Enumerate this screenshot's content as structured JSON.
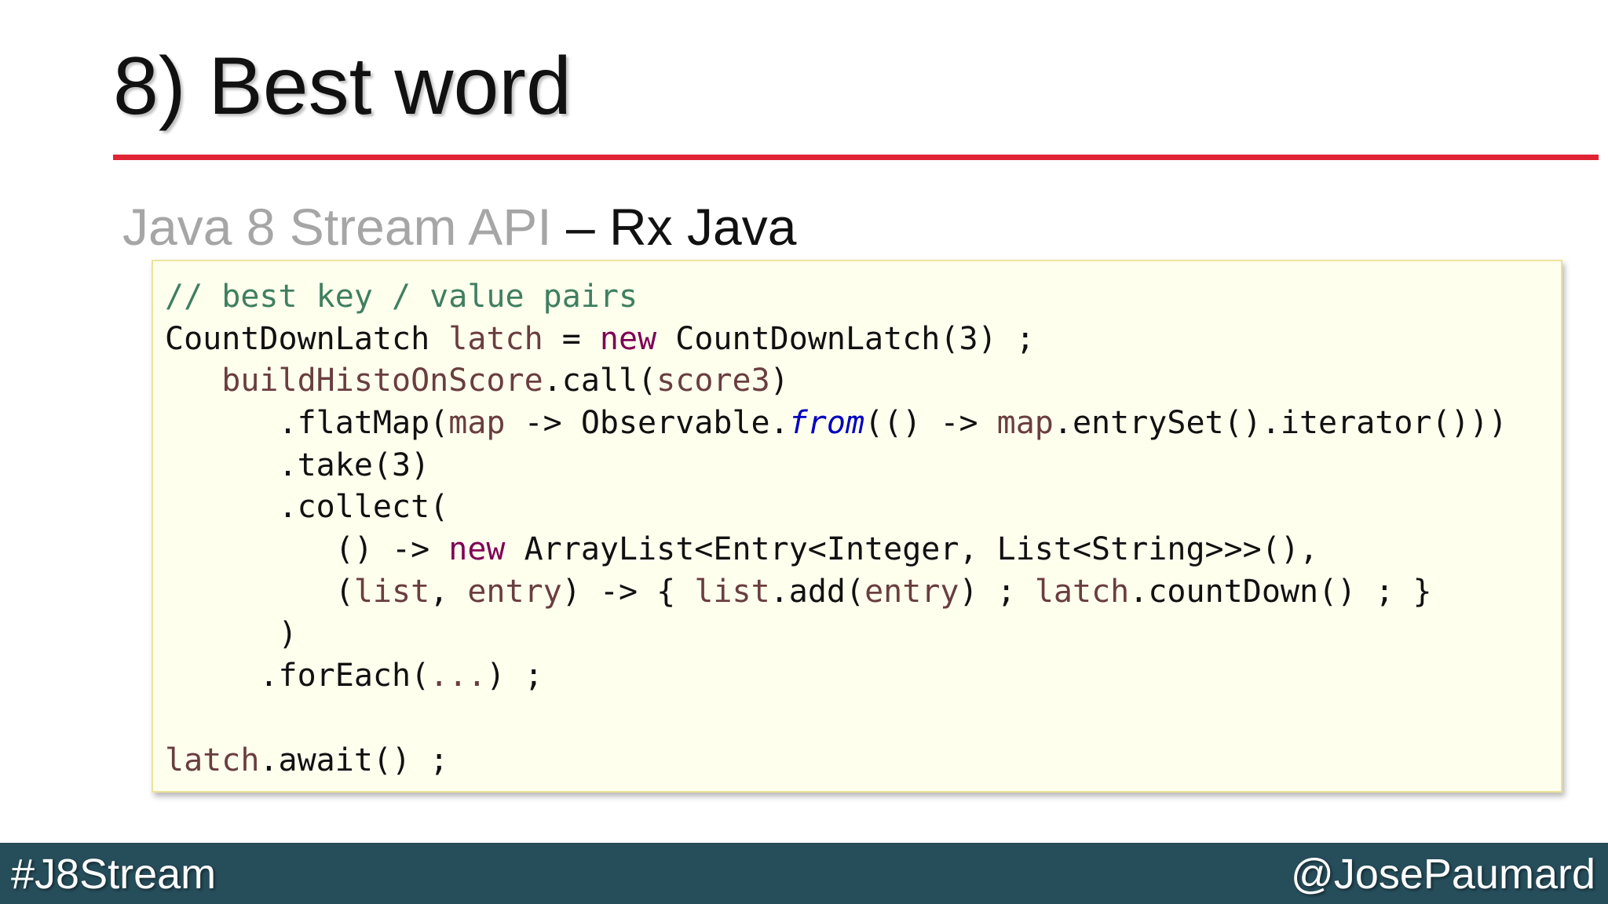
{
  "slide": {
    "title": "8) Best word",
    "subtitle": {
      "part1": "Java 8 Stream API",
      "separator": " – ",
      "part2": "Rx Java"
    },
    "code_lines": [
      [
        {
          "t": "// best key / value pairs",
          "c": "comment"
        }
      ],
      [
        {
          "t": "CountDownLatch ",
          "c": "plain"
        },
        {
          "t": "latch",
          "c": "var"
        },
        {
          "t": " = ",
          "c": "plain"
        },
        {
          "t": "new",
          "c": "keyword"
        },
        {
          "t": " CountDownLatch(3) ;",
          "c": "plain"
        }
      ],
      [
        {
          "t": "   ",
          "c": "plain"
        },
        {
          "t": "buildHistoOnScore",
          "c": "var"
        },
        {
          "t": ".call(",
          "c": "plain"
        },
        {
          "t": "score3",
          "c": "var"
        },
        {
          "t": ")",
          "c": "plain"
        }
      ],
      [
        {
          "t": "      .flatMap(",
          "c": "plain"
        },
        {
          "t": "map",
          "c": "var"
        },
        {
          "t": " -> Observable.",
          "c": "plain"
        },
        {
          "t": "from",
          "c": "static"
        },
        {
          "t": "(() -> ",
          "c": "plain"
        },
        {
          "t": "map",
          "c": "var"
        },
        {
          "t": ".entrySet().iterator()))",
          "c": "plain"
        }
      ],
      [
        {
          "t": "      .take(3)",
          "c": "plain"
        }
      ],
      [
        {
          "t": "      .collect(",
          "c": "plain"
        }
      ],
      [
        {
          "t": "         () -> ",
          "c": "plain"
        },
        {
          "t": "new",
          "c": "keyword"
        },
        {
          "t": " ArrayList<Entry<Integer, List<String>>>(),",
          "c": "plain"
        }
      ],
      [
        {
          "t": "         (",
          "c": "plain"
        },
        {
          "t": "list",
          "c": "var"
        },
        {
          "t": ", ",
          "c": "plain"
        },
        {
          "t": "entry",
          "c": "var"
        },
        {
          "t": ") -> { ",
          "c": "plain"
        },
        {
          "t": "list",
          "c": "var"
        },
        {
          "t": ".add(",
          "c": "plain"
        },
        {
          "t": "entry",
          "c": "var"
        },
        {
          "t": ") ; ",
          "c": "plain"
        },
        {
          "t": "latch",
          "c": "var"
        },
        {
          "t": ".countDown() ; }",
          "c": "plain"
        }
      ],
      [
        {
          "t": "      )",
          "c": "plain"
        }
      ],
      [
        {
          "t": "     .forEach(",
          "c": "plain"
        },
        {
          "t": "...",
          "c": "var"
        },
        {
          "t": ") ;",
          "c": "plain"
        }
      ],
      [
        {
          "t": "",
          "c": "plain"
        }
      ],
      [
        {
          "t": "latch",
          "c": "var"
        },
        {
          "t": ".await() ;",
          "c": "plain"
        }
      ]
    ]
  },
  "footer": {
    "hashtag": "#J8Stream",
    "handle": "@JosePaumard"
  },
  "colors": {
    "title_rule": "#e02433",
    "footer_bg": "#264d5a",
    "code_bg": "#ffffee",
    "comment": "#3f7f5f",
    "keyword": "#7f0055",
    "variable": "#6a3e3e",
    "static_method": "#0000c0"
  }
}
